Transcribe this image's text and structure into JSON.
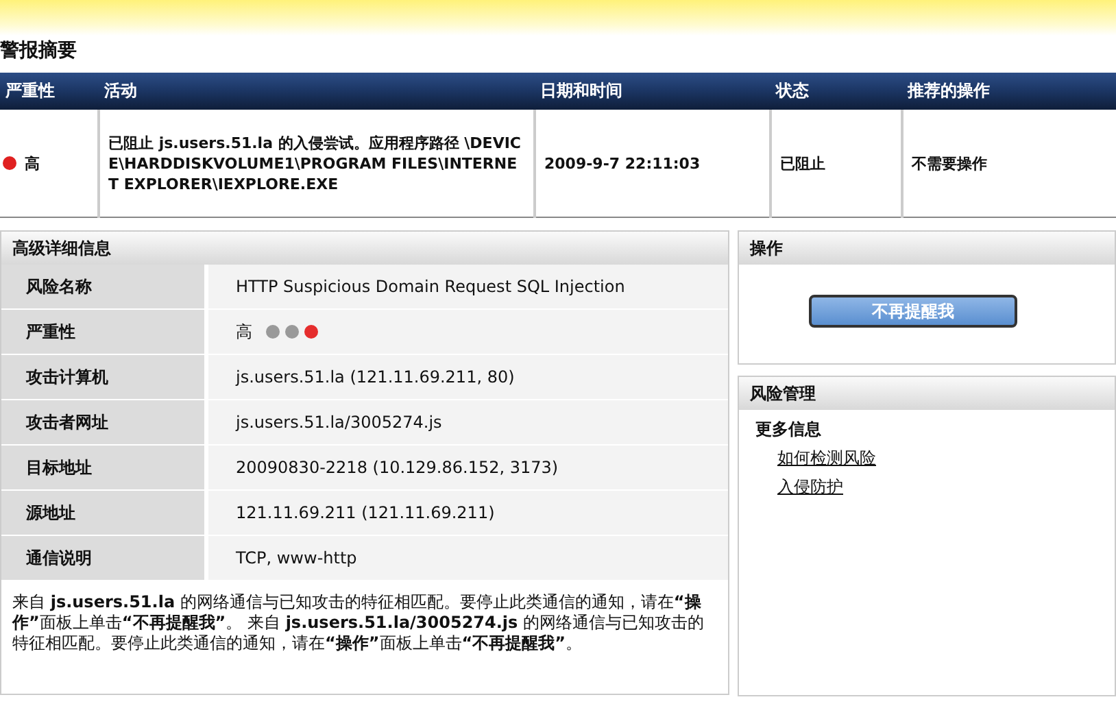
{
  "page_title": "警报摘要",
  "alert_table": {
    "columns": [
      "严重性",
      "活动",
      "日期和时间",
      "状态",
      "推荐的操作"
    ],
    "rows": [
      {
        "severity": "高",
        "color": "#e02020",
        "activity": "已阻止 js.users.51.la 的入侵尝试。应用程序路径 \\DEVICE\\HARDDISKVOLUME1\\PROGRAM FILES\\INTERNET EXPLORER\\IEXPLORE.EXE",
        "datetime": "2009-9-7 22:11:03",
        "status": "已阻止",
        "action": "不需要操作"
      }
    ]
  },
  "details": {
    "title": "高级详细信息",
    "rows": [
      {
        "label": "风险名称",
        "kind": "text",
        "value": "HTTP Suspicious Domain Request SQL Injection"
      },
      {
        "label": "严重性",
        "kind": "severity",
        "value": "高",
        "dots": [
          {
            "color": "#999999"
          },
          {
            "color": "#999999"
          },
          {
            "color": "#e52d2d"
          }
        ]
      },
      {
        "label": "攻击计算机",
        "kind": "text",
        "value": "js.users.51.la (121.11.69.211, 80)"
      },
      {
        "label": "攻击者网址",
        "kind": "text",
        "value": "js.users.51.la/3005274.js"
      },
      {
        "label": "目标地址",
        "kind": "text",
        "value": "20090830-2218 (10.129.86.152, 3173)"
      },
      {
        "label": "源地址",
        "kind": "text",
        "value": "121.11.69.211 (121.11.69.211)"
      },
      {
        "label": "通信说明",
        "kind": "text",
        "value": "TCP, www-http"
      }
    ],
    "description": "来自 **js.users.51.la** 的网络通信与已知攻击的特征相匹配。要停止此类通信的通知，请在**“操作”**面板上单击**“不再提醒我”**。 来自 **js.users.51.la/3005274.js** 的网络通信与已知攻击的特征相匹配。要停止此类通信的通知，请在**“操作”**面板上单击**“不再提醒我”**。"
  },
  "actions": {
    "title": "操作",
    "button": "不再提醒我"
  },
  "risk": {
    "title": "风险管理",
    "subtitle": "更多信息",
    "links": [
      "如何检测风险",
      "入侵防护"
    ]
  }
}
